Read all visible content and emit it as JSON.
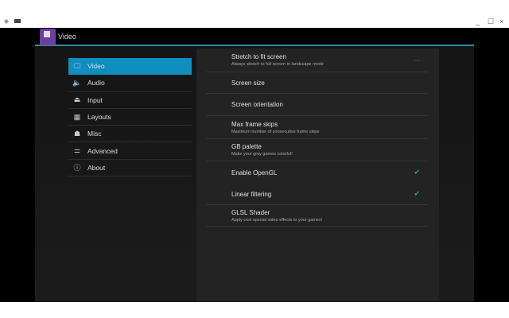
{
  "window": {
    "back_icon": "back-arrow",
    "minimize": "_",
    "maximize": "☐",
    "close": "×"
  },
  "header": {
    "title": "Video"
  },
  "nav": [
    {
      "label": "Video",
      "icon": "🖵",
      "active": true
    },
    {
      "label": "Audio",
      "icon": "🔈"
    },
    {
      "label": "Input",
      "icon": "⏏"
    },
    {
      "label": "Layouts",
      "icon": "▦"
    },
    {
      "label": "Misc",
      "icon": "☗"
    },
    {
      "label": "Advanced",
      "icon": "⚌"
    },
    {
      "label": "About",
      "icon": "ⓘ"
    }
  ],
  "settings": [
    {
      "title": "Stretch to fit screen",
      "subtitle": "Always stretch to full screen in landscape mode",
      "checked": false
    },
    {
      "title": "Screen size"
    },
    {
      "title": "Screen orientation"
    },
    {
      "title": "Max frame skips",
      "subtitle": "Maximum number of consecutive frame skips"
    },
    {
      "title": "GB palette",
      "subtitle": "Make your gray games colorful!"
    },
    {
      "title": "Enable OpenGL",
      "checked": true,
      "check": "✔"
    },
    {
      "title": "Linear filtering",
      "checked": true,
      "check": "✔"
    },
    {
      "title": "GLSL Shader",
      "subtitle": "Apply cool special video effects to your games!"
    }
  ]
}
